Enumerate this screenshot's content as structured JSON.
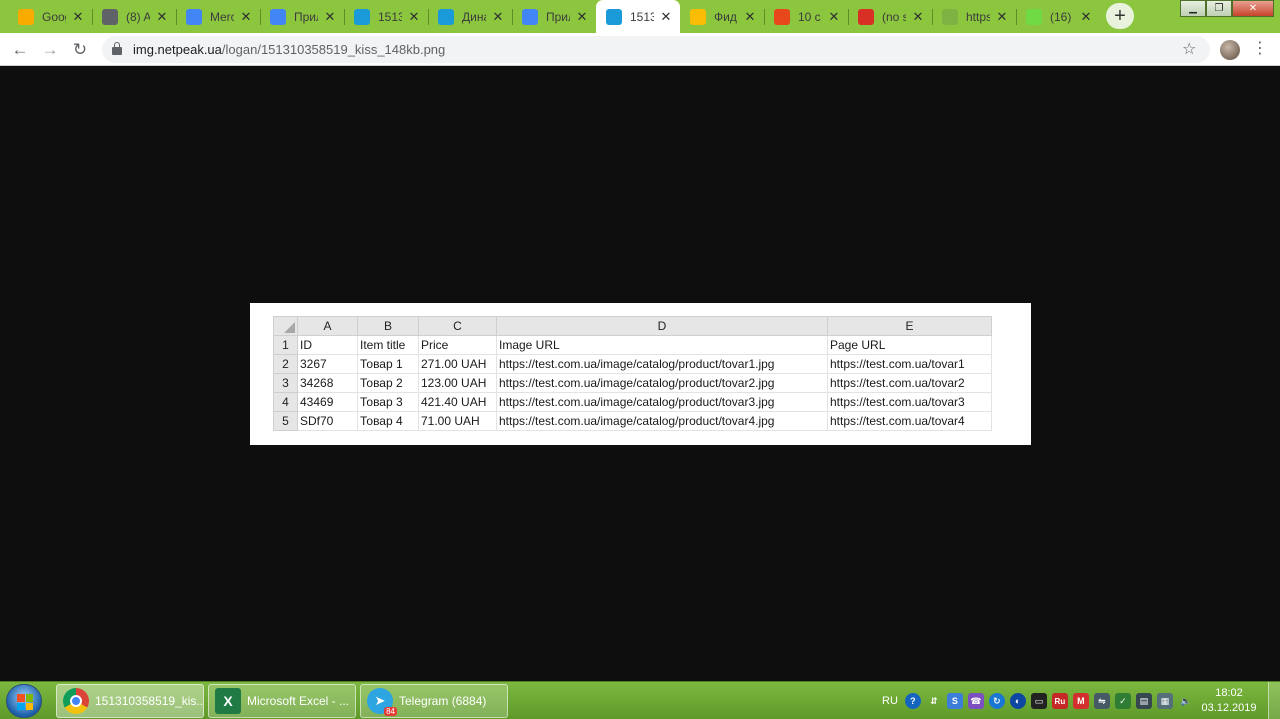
{
  "browser": {
    "tabs": [
      {
        "title": "Google",
        "icon": "analytics-icon",
        "color": "#f9ab00"
      },
      {
        "title": "(8) A",
        "icon": "printer-icon",
        "color": "#5f6368"
      },
      {
        "title": "Merchant",
        "icon": "merchant-icon",
        "color": "#4285f4"
      },
      {
        "title": "Прил",
        "icon": "docs-icon",
        "color": "#4285f4"
      },
      {
        "title": "1513",
        "icon": "triangle-icon",
        "color": "#1a9ad9"
      },
      {
        "title": "Дина",
        "icon": "triangle-icon",
        "color": "#1a9ad9"
      },
      {
        "title": "Прил",
        "icon": "docs-icon",
        "color": "#4285f4"
      },
      {
        "title": "1513",
        "icon": "triangle-icon",
        "color": "#1a9ad9"
      },
      {
        "title": "Фид",
        "icon": "google-ads-icon",
        "color": "#fbbc04"
      },
      {
        "title": "10 с",
        "icon": "fire-icon",
        "color": "#e8471c"
      },
      {
        "title": "(no s",
        "icon": "gmail-icon",
        "color": "#d93025"
      },
      {
        "title": "https",
        "icon": "loading-icon",
        "color": "#7cb342"
      },
      {
        "title": "(16)",
        "icon": "upwork-icon",
        "color": "#6fda44"
      }
    ],
    "active_tab_index": 7,
    "new_tab_label": "+",
    "close_label": "✕",
    "url_host": "img.netpeak.ua",
    "url_path": "/logan/151310358519_kiss_148kb.png"
  },
  "sheet": {
    "columns": [
      "A",
      "B",
      "C",
      "D",
      "E"
    ],
    "rows": [
      {
        "num": "1",
        "cells": [
          "ID",
          "Item title",
          "Price",
          "Image URL",
          "Page URL"
        ]
      },
      {
        "num": "2",
        "cells": [
          "3267",
          "Товар 1",
          "271.00 UAH",
          "https://test.com.ua/image/catalog/product/tovar1.jpg",
          "https://test.com.ua/tovar1"
        ]
      },
      {
        "num": "3",
        "cells": [
          "34268",
          "Товар 2",
          "123.00 UAH",
          "https://test.com.ua/image/catalog/product/tovar2.jpg",
          "https://test.com.ua/tovar2"
        ]
      },
      {
        "num": "4",
        "cells": [
          "43469",
          "Товар 3",
          "421.40 UAH",
          "https://test.com.ua/image/catalog/product/tovar3.jpg",
          "https://test.com.ua/tovar3"
        ]
      },
      {
        "num": "5",
        "cells": [
          "SDf70",
          "Товар 4",
          "71.00 UAH",
          "https://test.com.ua/image/catalog/product/tovar4.jpg",
          "https://test.com.ua/tovar4"
        ]
      }
    ]
  },
  "taskbar": {
    "items": [
      {
        "label": "151310358519_kis...",
        "icon": "chrome-icon"
      },
      {
        "label": "Microsoft Excel - ...",
        "icon": "excel-icon"
      },
      {
        "label": "Telegram (6884)",
        "icon": "telegram-icon",
        "badge": "84"
      }
    ],
    "language": "RU",
    "tray_ru": "Ru",
    "time": "18:02",
    "date": "03.12.2019"
  }
}
